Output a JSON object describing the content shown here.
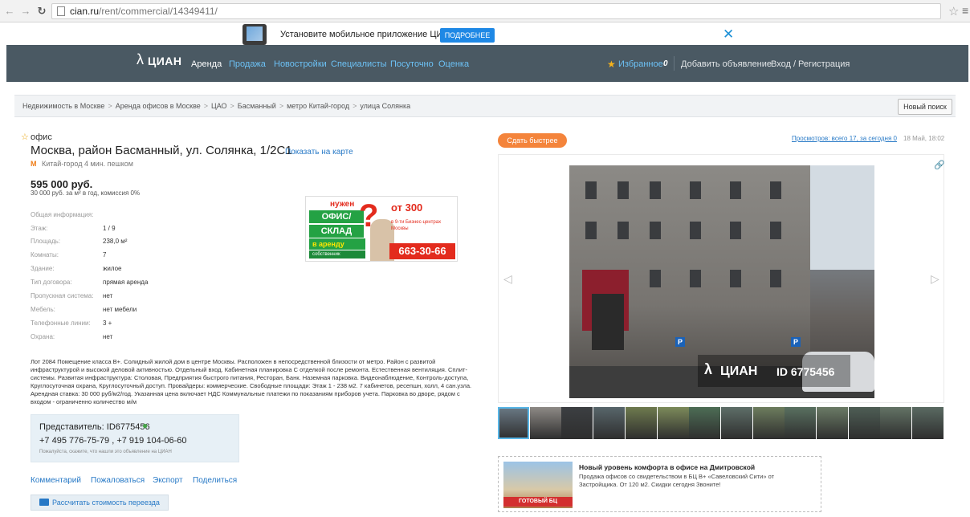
{
  "browser": {
    "url_host": "cian.ru",
    "url_path": "/rent/commercial/14349411/"
  },
  "promo": {
    "text": "Установите мобильное приложение ЦИАН",
    "more_label": "ПОДРОБНЕЕ"
  },
  "nav": {
    "logo": "ЦИАН",
    "items": [
      "Аренда",
      "Продажа",
      "Новостройки",
      "Специалисты",
      "Посуточно",
      "Оценка"
    ],
    "favorites_label": "Избранное",
    "favorites_count": "0",
    "add_listing": "Добавить объявление",
    "login": "Вход / Регистрация"
  },
  "breadcrumb": [
    "Недвижимость в Москве",
    "Аренда офисов в Москве",
    "ЦАО",
    "Басманный",
    "метро Китай-город",
    "улица Солянка"
  ],
  "new_search_label": "Новый поиск",
  "offer": {
    "type": "офис",
    "title": "Москва, район Басманный, ул. Солянка, 1/2С1",
    "show_on_map": "Показать на карте",
    "metro_icon": "М",
    "metro": "Китай-город 4 мин. пешком",
    "price": "595 000 руб.",
    "price_sub": "30 000 руб. за м² в год, комиссия 0%",
    "info_header": "Общая информация:",
    "info": [
      {
        "label": "Этаж:",
        "value": "1 / 9"
      },
      {
        "label": "Площадь:",
        "value": "238,0 м²"
      },
      {
        "label": "Комнаты:",
        "value": "7"
      },
      {
        "label": "Здание:",
        "value": "жилое"
      },
      {
        "label": "Тип договора:",
        "value": "прямая аренда"
      },
      {
        "label": "Пропускная система:",
        "value": "нет"
      },
      {
        "label": "Мебель:",
        "value": "нет мебели"
      },
      {
        "label": "Телефонные линии:",
        "value": "3 +"
      },
      {
        "label": "Охрана:",
        "value": "нет"
      }
    ],
    "description": "Лот 2084 Помещение класса В+. Солидный жилой дом в центре Москвы. Расположен в непосредственной близости от метро. Район с развитой инфраструктурой и высокой деловой активностью. Отдельный вход. Кабинетная планировка С отделкой после ремонта. Естественная вентиляция. Сплит-системы. Развитая инфраструктура: Столовая, Предприятия быстрого питания, Ресторан, Банк. Наземная парковка. Видеонаблюдение, Контроль-доступа, Круглосуточная охрана, Круглосуточный доступ. Провайдеры: коммерческие. Свободные площади: Этаж 1 - 238 м2. 7 кабинетов, ресепшн, холл, 4 сан.узла. Арендная ставка: 30 000 руб/м2/год. Указанная цена включает НДС Коммунальные платежи по показаниям приборов учета. Парковка во дворе, рядом с входом - ограниченно количество м/м"
  },
  "banner": {
    "need": "нужен",
    "office": "ОФИС/",
    "warehouse": "СКЛАД",
    "rent": "в аренду",
    "owner": "собственник",
    "from_price": "от 300",
    "bc": "в 9-ти Бизнес-центрах Москвы",
    "phone": "663-30-66"
  },
  "representative": {
    "name": "Представитель: ID6775456",
    "phones": "+7 495 776-75-79 , +7 919 104-06-60",
    "hint": "Пожалуйста, скажите, что нашли это объявление на ЦИАН"
  },
  "actions": [
    "Комментарий",
    "Пожаловаться",
    "Экспорт",
    "Поделиться"
  ],
  "calc_label": "Рассчитать стоимость переезда",
  "right": {
    "faster_label": "Сдать быстрее",
    "views": "Просмотров: всего 17, за сегодня 0",
    "date": "18 Май, 18:02"
  },
  "gallery": {
    "watermark_logo": "ЦИАН",
    "watermark_id": "ID 6775456",
    "thumb_colors": [
      "#6b7a86",
      "#8e8a86",
      "#3c3f42",
      "#58666b",
      "#6e7a4e",
      "#7c8a5a",
      "#4d6d55",
      "#5e6e68",
      "#6d7d5e",
      "#597060",
      "#6b7b66",
      "#4e5e55",
      "#637365",
      "#5a6a62"
    ]
  },
  "ad": {
    "img_label": "ГОТОВЫЙ БЦ",
    "title": "Новый уровень комфорта в офисе на Дмитровской",
    "text": "Продажа офисов со свидетельством в БЦ В+ «Савеловский Сити» от Застройщика. От 120 м2. Скидки сегодня Звоните!"
  }
}
